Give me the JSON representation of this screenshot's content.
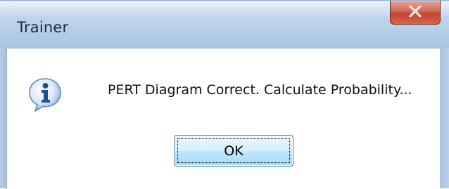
{
  "window": {
    "title": "Trainer",
    "close_icon": "close-icon"
  },
  "dialog": {
    "icon": "info-icon",
    "message": "PERT Diagram Correct. Calculate Probability...",
    "ok_label": "OK"
  },
  "colors": {
    "close_button": "#c0432d",
    "ok_border": "#3c7fb1",
    "titlebar": "#bcd2ea"
  }
}
